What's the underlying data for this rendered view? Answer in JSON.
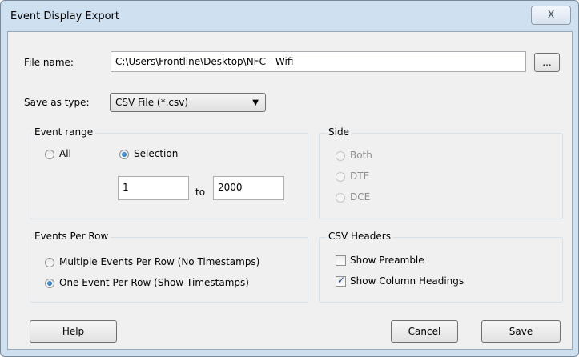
{
  "window": {
    "title": "Event Display Export",
    "close_icon": "X"
  },
  "file": {
    "label": "File name:",
    "value": "C:\\Users\\Frontline\\Desktop\\NFC - Wifi",
    "browse_label": "..."
  },
  "save_type": {
    "label": "Save as type:",
    "selected": "CSV File (*.csv)",
    "arrow": "▼"
  },
  "event_range": {
    "title": "Event range",
    "all_label": "All",
    "selection_label": "Selection",
    "selected": "Selection",
    "from": "1",
    "to_label": "to",
    "to": "2000"
  },
  "side": {
    "title": "Side",
    "options": [
      "Both",
      "DTE",
      "DCE"
    ],
    "enabled": false
  },
  "events_per_row": {
    "title": "Events Per Row",
    "options": [
      "Multiple Events Per Row (No Timestamps)",
      "One Event Per Row (Show Timestamps)"
    ],
    "selected": "One Event Per Row (Show Timestamps)"
  },
  "csv_headers": {
    "title": "CSV Headers",
    "show_preamble": {
      "label": "Show Preamble",
      "checked": false
    },
    "show_column_headings": {
      "label": "Show Column Headings",
      "checked": true
    }
  },
  "buttons": {
    "help": "Help",
    "cancel": "Cancel",
    "save": "Save"
  },
  "check_glyph": "✓"
}
